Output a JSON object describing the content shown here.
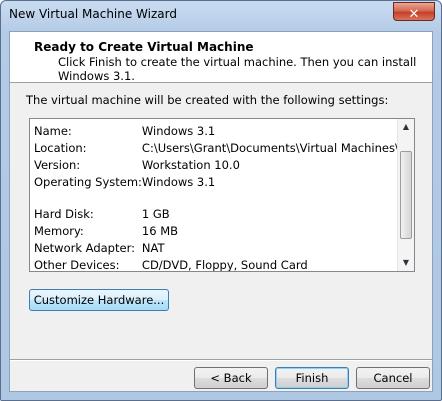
{
  "window": {
    "title": "New Virtual Machine Wizard",
    "close_glyph": "✕"
  },
  "header": {
    "title": "Ready to Create Virtual Machine",
    "subtitle": "Click Finish to create the virtual machine. Then you can install Windows 3.1."
  },
  "intro": "The virtual machine will be created with the following settings:",
  "settings": {
    "name_label": "Name:",
    "name_value": "Windows 3.1",
    "location_label": "Location:",
    "location_value": "C:\\Users\\Grant\\Documents\\Virtual Machines\\Window...",
    "version_label": "Version:",
    "version_value": "Workstation 10.0",
    "os_label": "Operating System:",
    "os_value": "Windows 3.1",
    "disk_label": "Hard Disk:",
    "disk_value": "1 GB",
    "memory_label": "Memory:",
    "memory_value": "16 MB",
    "network_label": "Network Adapter:",
    "network_value": "NAT",
    "other_label": "Other Devices:",
    "other_value": "CD/DVD, Floppy, Sound Card"
  },
  "scrollbar": {
    "up_glyph": "▲",
    "down_glyph": "▼"
  },
  "buttons": {
    "customize": "Customize Hardware...",
    "back": "< Back",
    "finish": "Finish",
    "cancel": "Cancel"
  }
}
